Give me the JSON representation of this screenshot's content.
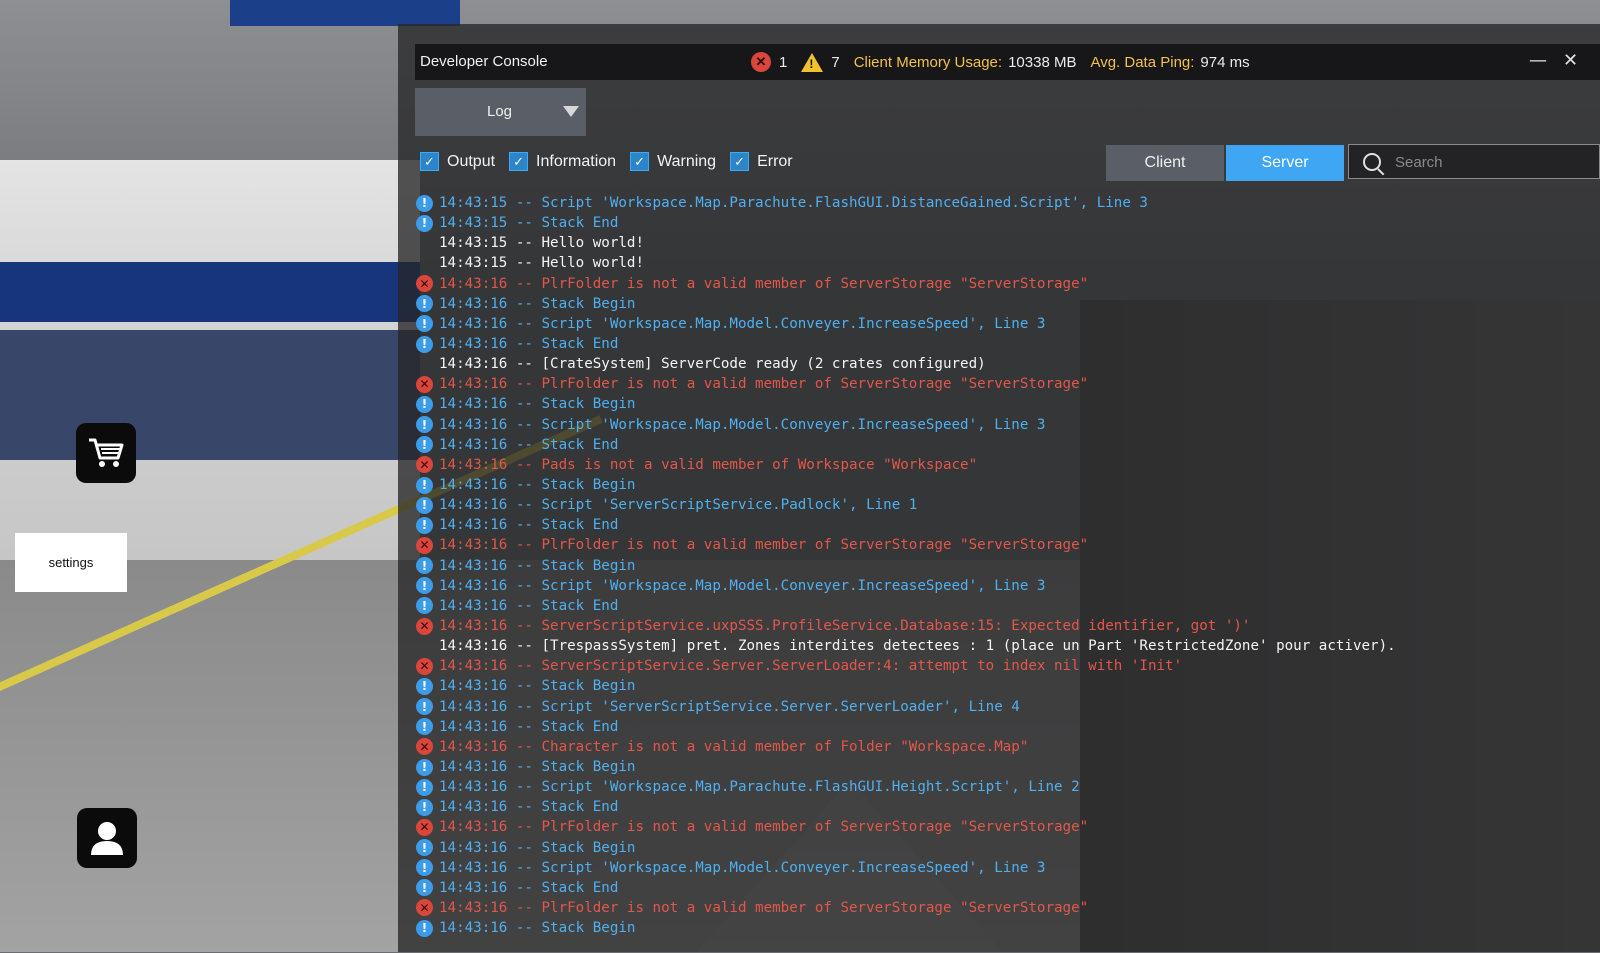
{
  "hud": {
    "settings_label": "settings",
    "cart_icon": "cart-icon",
    "profile_icon": "profile-icon"
  },
  "console": {
    "title": "Developer Console",
    "error_count": "1",
    "warning_count": "7",
    "memory_label": "Client Memory Usage:",
    "memory_value": "10338 MB",
    "ping_label": "Avg. Data Ping:",
    "ping_value": "974 ms",
    "log_dropdown": "Log",
    "filters": [
      {
        "label": "Output",
        "checked": true
      },
      {
        "label": "Information",
        "checked": true
      },
      {
        "label": "Warning",
        "checked": true
      },
      {
        "label": "Error",
        "checked": true
      }
    ],
    "client_label": "Client",
    "server_label": "Server",
    "search_placeholder": "Search",
    "colors": {
      "info": "#4fb0f0",
      "error": "#e2574a",
      "output": "#f4f4f4",
      "accent": "#3ea6f2"
    },
    "logs": [
      {
        "type": "info",
        "text": "14:43:15 -- Script 'Workspace.Map.Parachute.FlashGUI.DistanceGained.Script', Line 3"
      },
      {
        "type": "info",
        "text": "14:43:15 -- Stack End"
      },
      {
        "type": "output",
        "text": "14:43:15 -- Hello world!"
      },
      {
        "type": "output",
        "text": "14:43:15 -- Hello world!"
      },
      {
        "type": "error",
        "text": "14:43:16 -- PlrFolder is not a valid member of ServerStorage \"ServerStorage\""
      },
      {
        "type": "info",
        "text": "14:43:16 -- Stack Begin"
      },
      {
        "type": "info",
        "text": "14:43:16 -- Script 'Workspace.Map.Model.Conveyer.IncreaseSpeed', Line 3"
      },
      {
        "type": "info",
        "text": "14:43:16 -- Stack End"
      },
      {
        "type": "output",
        "text": "14:43:16 -- [CrateSystem] ServerCode ready (2 crates configured)"
      },
      {
        "type": "error",
        "text": "14:43:16 -- PlrFolder is not a valid member of ServerStorage \"ServerStorage\""
      },
      {
        "type": "info",
        "text": "14:43:16 -- Stack Begin"
      },
      {
        "type": "info",
        "text": "14:43:16 -- Script 'Workspace.Map.Model.Conveyer.IncreaseSpeed', Line 3"
      },
      {
        "type": "info",
        "text": "14:43:16 -- Stack End"
      },
      {
        "type": "error",
        "text": "14:43:16 -- Pads is not a valid member of Workspace \"Workspace\""
      },
      {
        "type": "info",
        "text": "14:43:16 -- Stack Begin"
      },
      {
        "type": "info",
        "text": "14:43:16 -- Script 'ServerScriptService.Padlock', Line 1"
      },
      {
        "type": "info",
        "text": "14:43:16 -- Stack End"
      },
      {
        "type": "error",
        "text": "14:43:16 -- PlrFolder is not a valid member of ServerStorage \"ServerStorage\""
      },
      {
        "type": "info",
        "text": "14:43:16 -- Stack Begin"
      },
      {
        "type": "info",
        "text": "14:43:16 -- Script 'Workspace.Map.Model.Conveyer.IncreaseSpeed', Line 3"
      },
      {
        "type": "info",
        "text": "14:43:16 -- Stack End"
      },
      {
        "type": "error",
        "text": "14:43:16 -- ServerScriptService.uxpSSS.ProfileService.Database:15: Expected identifier, got ')'"
      },
      {
        "type": "output",
        "text": "14:43:16 -- [TrespassSystem] pret. Zones interdites detectees : 1 (place un Part 'RestrictedZone' pour activer)."
      },
      {
        "type": "error",
        "text": "14:43:16 -- ServerScriptService.Server.ServerLoader:4: attempt to index nil with 'Init'"
      },
      {
        "type": "info",
        "text": "14:43:16 -- Stack Begin"
      },
      {
        "type": "info",
        "text": "14:43:16 -- Script 'ServerScriptService.Server.ServerLoader', Line 4"
      },
      {
        "type": "info",
        "text": "14:43:16 -- Stack End"
      },
      {
        "type": "error",
        "text": "14:43:16 -- Character is not a valid member of Folder \"Workspace.Map\""
      },
      {
        "type": "info",
        "text": "14:43:16 -- Stack Begin"
      },
      {
        "type": "info",
        "text": "14:43:16 -- Script 'Workspace.Map.Parachute.FlashGUI.Height.Script', Line 2"
      },
      {
        "type": "info",
        "text": "14:43:16 -- Stack End"
      },
      {
        "type": "error",
        "text": "14:43:16 -- PlrFolder is not a valid member of ServerStorage \"ServerStorage\""
      },
      {
        "type": "info",
        "text": "14:43:16 -- Stack Begin"
      },
      {
        "type": "info",
        "text": "14:43:16 -- Script 'Workspace.Map.Model.Conveyer.IncreaseSpeed', Line 3"
      },
      {
        "type": "info",
        "text": "14:43:16 -- Stack End"
      },
      {
        "type": "error",
        "text": "14:43:16 -- PlrFolder is not a valid member of ServerStorage \"ServerStorage\""
      },
      {
        "type": "info",
        "text": "14:43:16 -- Stack Begin"
      }
    ]
  }
}
